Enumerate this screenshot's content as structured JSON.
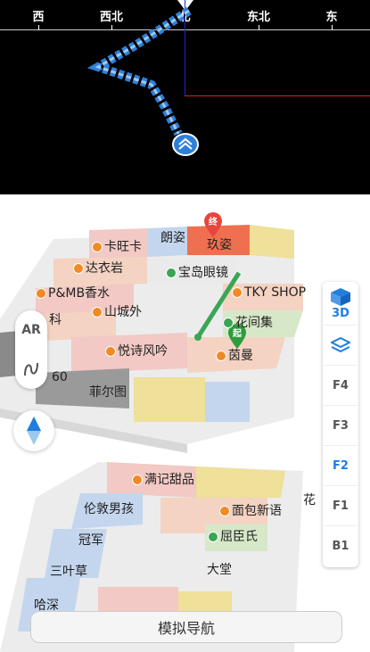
{
  "compass": {
    "directions": [
      "西",
      "西北",
      "北",
      "东北",
      "东"
    ]
  },
  "map": {
    "upper_floor_shops": [
      "卡旺卡",
      "朗姿",
      "玖姿",
      "达衣岩",
      "宝岛眼镜",
      "P&MB香水",
      "TKY SHOP",
      "山城外",
      "科",
      "花间集",
      "悦诗风吟",
      "茵曼",
      "60",
      "菲尔图"
    ],
    "lower_floor_shops": [
      "满记甜品",
      "伦敦男孩",
      "面包新语",
      "冠军",
      "屈臣氏",
      "三叶草",
      "大堂",
      "哈深",
      "花"
    ],
    "end_marker": "终",
    "start_marker": "起"
  },
  "left_controls": {
    "ar_label": "AR",
    "route_icon": "route-icon"
  },
  "floor_selector": {
    "view_3d_label": "3D",
    "layers_icon": "layers-icon",
    "floors": [
      "F4",
      "F3",
      "F2",
      "F1",
      "B1"
    ],
    "active_floor": "F2"
  },
  "compass_button_icon": "compass-arrow-icon",
  "simulate_nav_label": "模拟导航",
  "colors": {
    "active_floor": "#1f7ee0",
    "route": "#3aa655",
    "ar_arrow": "#2f7fd8",
    "end_marker": "#e8453c",
    "start_marker": "#2d9c3c"
  }
}
